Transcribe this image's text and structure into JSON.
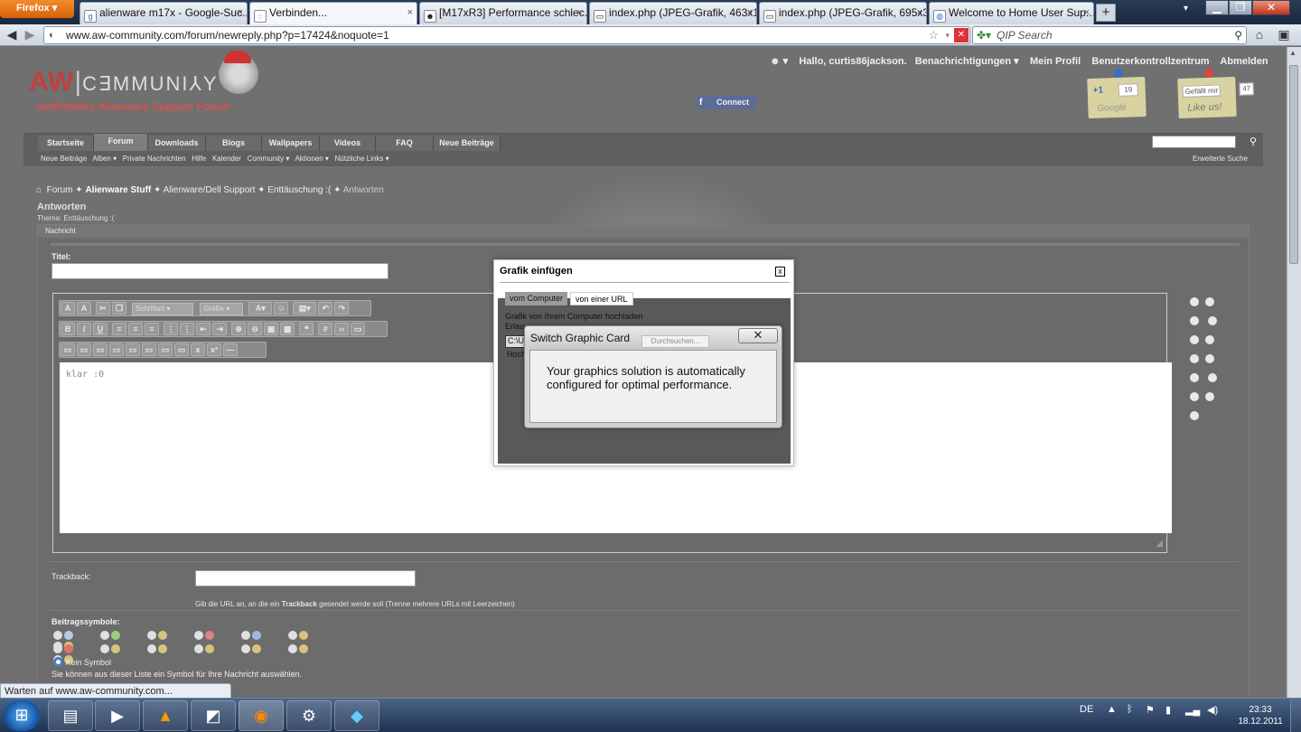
{
  "browser": {
    "menu_button": "Firefox",
    "tabs": [
      {
        "label": "alienware m17x - Google-Suc...",
        "icon": "google-icon"
      },
      {
        "label": "Verbinden...",
        "icon": "loading-icon",
        "active": true
      },
      {
        "label": "[M17xR3] Performance schlec...",
        "icon": "alien-icon"
      },
      {
        "label": "index.php (JPEG-Grafik, 463x1...",
        "icon": "image-icon"
      },
      {
        "label": "index.php (JPEG-Grafik, 695x3...",
        "icon": "image-icon"
      },
      {
        "label": "Welcome to Home User Sup...",
        "icon": "globe-icon"
      }
    ],
    "new_tab": "+",
    "url": "www.aw-community.com/forum/newreply.php?p=17424&noquote=1",
    "search_placeholder": "QIP Search",
    "status": "Warten auf www.aw-community.com..."
  },
  "site": {
    "logo_main": "AW",
    "logo_community": "C∃MMUNI⅄Y",
    "logo_sub": "inoffizielles Alienware Support Forum",
    "facebook_connect": "Connect",
    "greeting": "Hallo, curtis86jackson.",
    "user_links": [
      "Benachrichtigungen ▾",
      "Mein Profil",
      "Benutzerkontrollzentrum",
      "Abmelden"
    ],
    "gplus": {
      "label": "+1",
      "count": "19",
      "brand": "Google"
    },
    "fb_like": {
      "label": "Gefällt mir",
      "count": "47",
      "script": "Like us!"
    },
    "main_tabs": [
      "Startseite",
      "Forum",
      "Downloads",
      "Blogs",
      "Wallpapers",
      "Videos",
      "FAQ",
      "Neue Beiträge"
    ],
    "current_tab": "Forum",
    "sub_links": [
      "Neue Beiträge",
      "Alben ▾",
      "Private Nachrichten",
      "Hilfe",
      "Kalender",
      "Community ▾",
      "Aktionen ▾",
      "Nützliche Links ▾"
    ],
    "advanced_search": "Erweiterte Suche",
    "breadcrumb": [
      "Forum",
      "Alienware Stuff",
      "Alienware/Dell Support",
      "Enttäuschung :(",
      "Antworten"
    ],
    "page_title": "Antworten",
    "thread_label": "Thema: Enttäuschung :("
  },
  "form": {
    "panel_header": "Nachricht",
    "title_label": "Titel:",
    "title_value": "",
    "font_select": "Schriftart",
    "size_select": "Größe",
    "message_text": "klar :0",
    "trackback_label": "Trackback:",
    "trackback_hint": "Gib die URL an, an die ein Trackback gesendet werde soll (Trenne mehrere URLs mit Leerzeichen)",
    "trackback_hint_bold": "Trackback",
    "symbols_label": "Beitragssymbole:",
    "no_symbol": "Kein Symbol",
    "symbols_hint": "Sie können aus dieser Liste ein Symbol für Ihre Nachricht auswählen."
  },
  "image_dialog": {
    "title": "Grafik einfügen",
    "close": "x",
    "tab_computer": "vom Computer",
    "tab_url": "von einer URL",
    "upload_label": "Grafik von Ihrem Computer hochladen",
    "allowed_label": "Erlau",
    "path_value": "C:\\U",
    "upload_button": "Hoch"
  },
  "switch_dialog": {
    "title": "Switch Graphic Card",
    "close": "✕",
    "hidden_button": "Durchsuchen...",
    "message": "Your graphics solution is automatically configured for optimal performance."
  },
  "taskbar": {
    "start": "⊞",
    "apps": [
      "folder-icon",
      "media-player-icon",
      "vlc-icon",
      "app-icon",
      "firefox-icon",
      "steam-icon",
      "network-icon"
    ],
    "lang": "DE",
    "time": "23:33",
    "date": "18.12.2011"
  }
}
